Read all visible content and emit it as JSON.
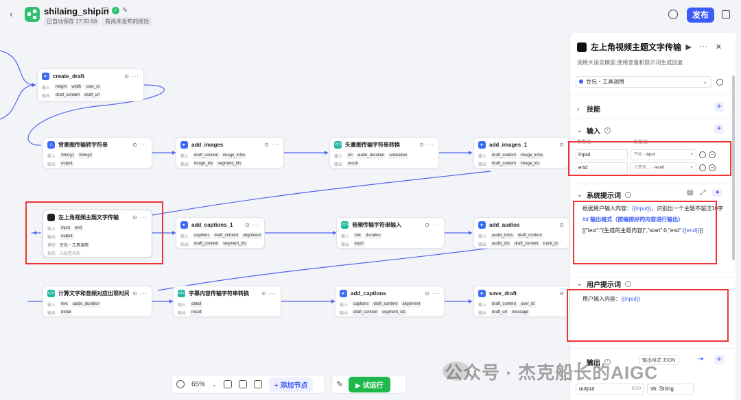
{
  "header": {
    "app_name": "shilaing_shipin",
    "autosave": "已自动保存 17:50:58",
    "unpublished": "有尚未发布的修改",
    "publish_label": "发布"
  },
  "nodes": {
    "create_draft": {
      "title": "create_draft",
      "in_label": "输入",
      "inputs": [
        "height",
        "width",
        "user_id"
      ],
      "out_label": "输出",
      "outputs": [
        "draft_content",
        "draft_url"
      ]
    },
    "bg_image": {
      "title": "背景图传输转字符串",
      "in_label": "输入",
      "inputs": [
        "String1",
        "String2"
      ],
      "out_label": "输出",
      "outputs": [
        "output"
      ]
    },
    "add_images": {
      "title": "add_images",
      "in_label": "输入",
      "inputs": [
        "draft_content",
        "image_infos"
      ],
      "out_label": "输出",
      "outputs": [
        "image_ids",
        "segment_ids"
      ]
    },
    "vector_image": {
      "title": "矢量图传输字符串转换",
      "in_label": "输入",
      "inputs": [
        "url",
        "audio_duration",
        "animation"
      ],
      "out_label": "输出",
      "outputs": [
        "result"
      ]
    },
    "add_images_1": {
      "title": "add_images_1",
      "in_label": "输入",
      "inputs": [
        "draft_content",
        "image_infos"
      ],
      "out_label": "输出",
      "outputs": [
        "draft_content",
        "image_ids"
      ]
    },
    "llm_title": {
      "title": "左上角视频主题文字传输",
      "in_label": "输入",
      "inputs": [
        "input",
        "end"
      ],
      "out_label": "输出",
      "outputs": [
        "output"
      ],
      "model_label": "模型",
      "model_value": "豆包・工具调用",
      "skill_label": "技能",
      "skill_value": "未配置技能"
    },
    "add_captions_1": {
      "title": "add_captions_1",
      "in_label": "输入",
      "inputs": [
        "captions",
        "draft_content",
        "alignment"
      ],
      "out_label": "输出",
      "outputs": [
        "draft_content",
        "segment_ids"
      ]
    },
    "audio_str": {
      "title": "音频传输字符串输入",
      "in_label": "输入",
      "inputs": [
        "link",
        "duration"
      ],
      "out_label": "输出",
      "outputs": [
        "key0"
      ]
    },
    "add_audios": {
      "title": "add_audios",
      "in_label": "输入",
      "inputs": [
        "audio_infos",
        "draft_content"
      ],
      "out_label": "输出",
      "outputs": [
        "audio_ids",
        "draft_content",
        "track_id"
      ]
    },
    "calc_time": {
      "title": "计算文字和音频对应出现时间",
      "in_label": "输入",
      "inputs": [
        "text",
        "audio_duration"
      ],
      "out_label": "输出",
      "outputs": [
        "detail"
      ]
    },
    "caption_str": {
      "title": "字幕内容传输字符串转换",
      "in_label": "输入",
      "inputs": [
        "detail"
      ],
      "out_label": "输出",
      "outputs": [
        "result"
      ]
    },
    "add_captions": {
      "title": "add_captions",
      "in_label": "输入",
      "inputs": [
        "captions",
        "draft_content",
        "alignment"
      ],
      "out_label": "输出",
      "outputs": [
        "draft_content",
        "segment_ids"
      ]
    },
    "save_draft": {
      "title": "save_draft",
      "in_label": "输入",
      "inputs": [
        "draft_content",
        "user_id"
      ],
      "out_label": "输出",
      "outputs": [
        "draft_url",
        "message"
      ]
    }
  },
  "toolbar": {
    "zoom": "65%",
    "add_node_label": "+ 添加节点",
    "run_label": "▶ 试运行"
  },
  "watermark": "公众号 · 杰克船长的AIGC",
  "panel": {
    "title": "左上角视频主题文字传输",
    "description": "调用大语言模型,使用变量和提示词生成回复",
    "model": "豆包・工具调用",
    "skills_label": "技能",
    "inputs_label": "输入",
    "col_name": "参数名",
    "col_value": "变量值",
    "inputs": [
      {
        "name": "input",
        "source": "开始 - ",
        "var": "input"
      },
      {
        "name": "end",
        "source": "计算音… - ",
        "var": "result"
      }
    ],
    "system_prompt_label": "系统提示词",
    "system_prompt": {
      "line1_pre": "根据用户输入内容：",
      "line1_var": "{{input}}",
      "line1_post": "，识别出一个主题不超过10字",
      "heading": "## 输出格式（按编排好的内容进行输出）",
      "line3_pre": "[{\"text\":\"{生成的主题内容}\",\"start\":0,\"end\":",
      "line3_var": "{{end}}",
      "line3_post": "}]"
    },
    "user_prompt_label": "用户提示词",
    "user_prompt_pre": "用户输入内容：",
    "user_prompt_var": "{{input}}",
    "output_label": "输出",
    "output_format": "输出格式 JSON",
    "output_name": "output",
    "output_count": "6/20",
    "output_type": "str. String"
  },
  "colors": {
    "accent": "#3c5cf6",
    "run": "#1fb84a",
    "highlight": "#ee3333"
  }
}
